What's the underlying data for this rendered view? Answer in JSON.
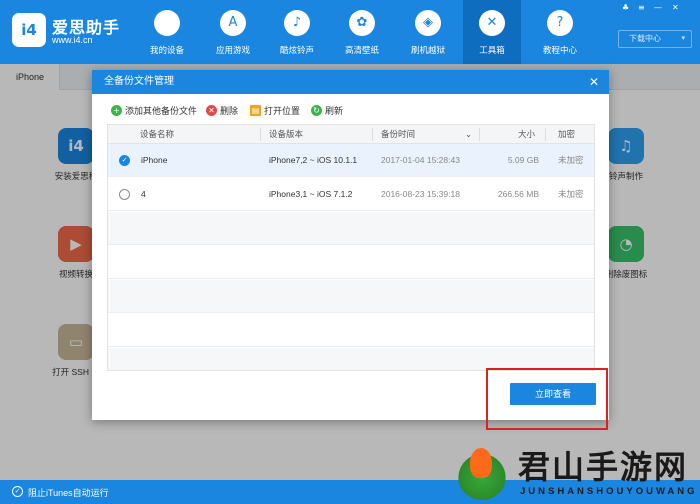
{
  "app": {
    "brand_name": "爱思助手",
    "brand_url": "www.i4.cn",
    "logo_text": "i4"
  },
  "nav": [
    {
      "label": "我的设备",
      "icon": "apple-icon",
      "glyph": ""
    },
    {
      "label": "应用游戏",
      "icon": "app-store-icon",
      "glyph": "A"
    },
    {
      "label": "酷炫铃声",
      "icon": "bell-icon",
      "glyph": "♪"
    },
    {
      "label": "高清壁纸",
      "icon": "flower-icon",
      "glyph": "✿"
    },
    {
      "label": "刷机越狱",
      "icon": "dropbox-icon",
      "glyph": "◈"
    },
    {
      "label": "工具箱",
      "icon": "tools-icon",
      "glyph": "✕"
    },
    {
      "label": "教程中心",
      "icon": "help-icon",
      "glyph": "?"
    }
  ],
  "header": {
    "download_label": "下载中心",
    "caret": "▾",
    "window_controls": [
      "♣",
      "≡",
      "—",
      "✕"
    ]
  },
  "page": {
    "tab_label": "iPhone"
  },
  "tools": [
    {
      "label": "安装爱思移",
      "glyph": "i4",
      "color": "#1a86e0"
    },
    {
      "label": "视频转换",
      "glyph": "▶",
      "color": "#f06a4a"
    },
    {
      "label": "打开 SSH 通",
      "glyph": "▭",
      "color": "#c9b89a"
    },
    {
      "label": "铃声制作",
      "glyph": "♫",
      "color": "#2da0f0"
    },
    {
      "label": "删除废图标",
      "glyph": "◔",
      "color": "#38c26a"
    }
  ],
  "dialog": {
    "title": "全备份文件管理",
    "close_glyph": "✕",
    "toolbar": [
      {
        "label": "添加其他备份文件",
        "icon": "add-icon",
        "glyph": "+",
        "color": "#3cb44a"
      },
      {
        "label": "删除",
        "icon": "delete-icon",
        "glyph": "✕",
        "color": "#e04a4a"
      },
      {
        "label": "打开位置",
        "icon": "folder-icon",
        "glyph": "▤",
        "color": "#f0a21a"
      },
      {
        "label": "刷新",
        "icon": "refresh-icon",
        "glyph": "↻",
        "color": "#3cb44a"
      }
    ],
    "columns": {
      "device_name": "设备名称",
      "device_version": "设备版本",
      "backup_time": "备份时间",
      "sort_caret": "⌄",
      "size": "大小",
      "encryption": "加密"
    },
    "rows": [
      {
        "name": "iPhone",
        "version": "iPhone7,2 ~ iOS 10.1.1",
        "time": "2017-01-04 15:28:43",
        "size": "5.09 GB",
        "encryption": "未加密",
        "selected": true
      },
      {
        "name": "4",
        "version": "iPhone3,1 ~ iOS 7.1.2",
        "time": "2016-08-23 15:39:18",
        "size": "266.56 MB",
        "encryption": "未加密",
        "selected": false
      }
    ],
    "check_glyph": "✓",
    "view_button": "立即查看"
  },
  "footer": {
    "itunes_label": "阻止iTunes自动运行",
    "check_glyph": "✓"
  },
  "watermark": {
    "title": "君山手游网",
    "subtitle": "JUNSHANSHOUYOUWANG"
  }
}
